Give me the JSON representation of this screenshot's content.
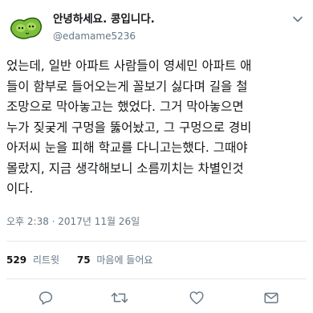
{
  "author": {
    "display_name": "안녕하세요. 콩입니다.",
    "handle": "@edamame5236"
  },
  "tweet": {
    "text": "었는데, 일반 아파트 사람들이 영세민 아파트 애\n들이 함부로 들어오는게 꼴보기 싫다며 길을 철\n조망으로 막아놓고는 했었다. 그거 막아놓으면\n누가 짖궂게 구멍을 뚫어놨고, 그 구멍으로 경비\n아저씨 눈을 피해 학교를 다니고는했다. 그때야\n몰랐지, 지금 생각해보니 소름끼치는 차별인것\n이다.",
    "timestamp": "오후 2:38 · 2017년 11월 26일"
  },
  "stats": {
    "retweets_count": "529",
    "retweets_label": "리트윗",
    "likes_count": "75",
    "likes_label": "마음에 들어요"
  },
  "icons": {
    "caret": "chevron-down-icon",
    "reply": "reply-icon",
    "retweet": "retweet-icon",
    "like": "heart-icon",
    "dm": "envelope-icon"
  },
  "colors": {
    "text": "#14171a",
    "secondary": "#657786",
    "divider": "#e1e8ed",
    "icon": "#657786",
    "avatar_green": "#7bbf3a"
  }
}
